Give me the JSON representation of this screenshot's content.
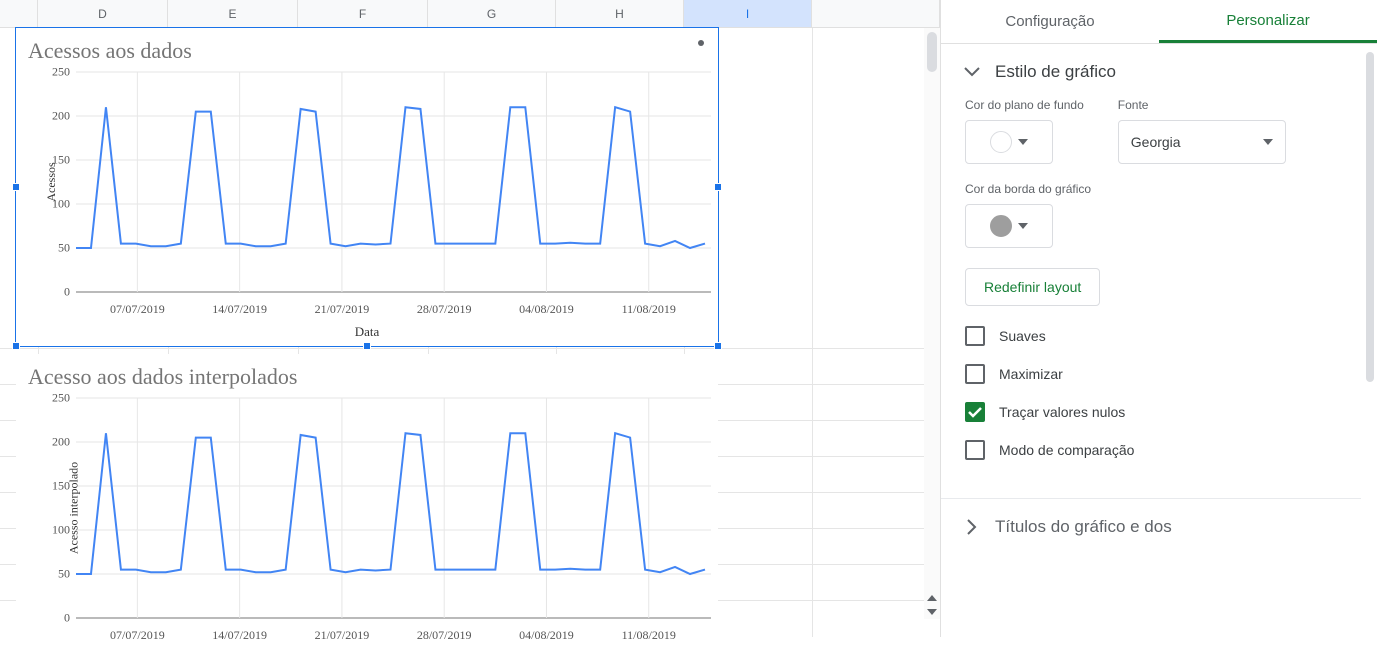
{
  "columns": [
    "D",
    "E",
    "F",
    "G",
    "H",
    "I"
  ],
  "selected_column": "I",
  "chart_a": {
    "title": "Acessos aos dados",
    "y_label": "Acessos",
    "x_label": "Data"
  },
  "chart_b": {
    "title": "Acesso aos dados interpolados",
    "y_label": "Acesso interpolado"
  },
  "sidebar": {
    "tabs": {
      "config": "Configuração",
      "customize": "Personalizar"
    },
    "section_style": "Estilo de gráfico",
    "bgcolor_label": "Cor do plano de fundo",
    "font_label": "Fonte",
    "font_value": "Georgia",
    "border_color_label": "Cor da borda do gráfico",
    "reset_layout": "Redefinir layout",
    "checks": {
      "smooth": "Suaves",
      "maximize": "Maximizar",
      "plot_null": "Traçar valores nulos",
      "compare": "Modo de comparação"
    },
    "next_section": "Títulos do gráfico e dos"
  },
  "chart_data": [
    {
      "type": "line",
      "title": "Acessos aos dados",
      "xlabel": "Data",
      "ylabel": "Acessos",
      "ylim": [
        0,
        250
      ],
      "y_ticks": [
        0,
        50,
        100,
        150,
        200,
        250
      ],
      "x_ticks": [
        "07/07/2019",
        "14/07/2019",
        "21/07/2019",
        "28/07/2019",
        "04/08/2019",
        "11/08/2019"
      ],
      "series": [
        {
          "name": "Acessos",
          "x": [
            0,
            1,
            2,
            3,
            4,
            5,
            6,
            7,
            8,
            9,
            10,
            11,
            12,
            13,
            14,
            15,
            16,
            17,
            18,
            19,
            20,
            21,
            22,
            23,
            24,
            25,
            26,
            27,
            28,
            29,
            30,
            31,
            32,
            33,
            34,
            35,
            36,
            37,
            38,
            39,
            40,
            41,
            42
          ],
          "y": [
            50,
            50,
            210,
            55,
            55,
            52,
            52,
            55,
            205,
            205,
            55,
            55,
            52,
            52,
            55,
            208,
            205,
            55,
            52,
            55,
            54,
            55,
            210,
            208,
            55,
            55,
            55,
            55,
            55,
            210,
            210,
            55,
            55,
            56,
            55,
            55,
            210,
            205,
            55,
            52,
            58,
            50,
            55
          ]
        }
      ]
    },
    {
      "type": "line",
      "title": "Acesso aos dados interpolados",
      "ylabel": "Acesso interpolado",
      "ylim": [
        0,
        250
      ],
      "y_ticks": [
        0,
        50,
        100,
        150,
        200,
        250
      ],
      "x_ticks": [
        "07/07/2019",
        "14/07/2019",
        "21/07/2019",
        "28/07/2019",
        "04/08/2019",
        "11/08/2019"
      ],
      "series": [
        {
          "name": "Acesso interpolado",
          "x": [
            0,
            1,
            2,
            3,
            4,
            5,
            6,
            7,
            8,
            9,
            10,
            11,
            12,
            13,
            14,
            15,
            16,
            17,
            18,
            19,
            20,
            21,
            22,
            23,
            24,
            25,
            26,
            27,
            28,
            29,
            30,
            31,
            32,
            33,
            34,
            35,
            36,
            37,
            38,
            39,
            40,
            41,
            42
          ],
          "y": [
            50,
            50,
            210,
            55,
            55,
            52,
            52,
            55,
            205,
            205,
            55,
            55,
            52,
            52,
            55,
            208,
            205,
            55,
            52,
            55,
            54,
            55,
            210,
            208,
            55,
            55,
            55,
            55,
            55,
            210,
            210,
            55,
            55,
            56,
            55,
            55,
            210,
            205,
            55,
            52,
            58,
            50,
            55
          ]
        }
      ]
    }
  ]
}
